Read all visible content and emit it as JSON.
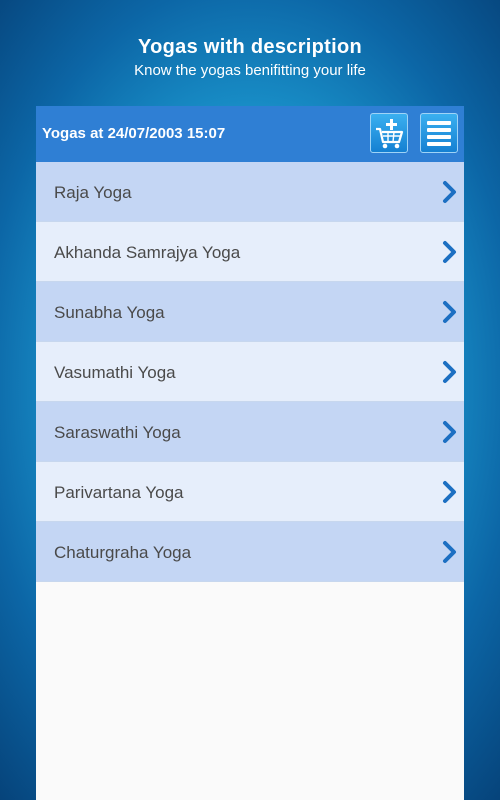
{
  "hero": {
    "title": "Yogas with description",
    "subtitle": "Know the yogas benifitting your life"
  },
  "header": {
    "title": "Yogas at 24/07/2003  15:07",
    "cart_icon": "cart-add-icon",
    "menu_icon": "hamburger-menu-icon"
  },
  "yogas": [
    {
      "label": "Raja Yoga"
    },
    {
      "label": "Akhanda Samrajya Yoga"
    },
    {
      "label": "Sunabha Yoga"
    },
    {
      "label": "Vasumathi Yoga"
    },
    {
      "label": "Saraswathi Yoga"
    },
    {
      "label": "Parivartana Yoga"
    },
    {
      "label": "Chaturgraha Yoga"
    }
  ],
  "colors": {
    "header_bg": "#2f7fd4",
    "row_odd": "#c4d6f4",
    "row_even": "#e6eefb",
    "chevron": "#1c6fc2",
    "text": "#4a4a4a"
  }
}
